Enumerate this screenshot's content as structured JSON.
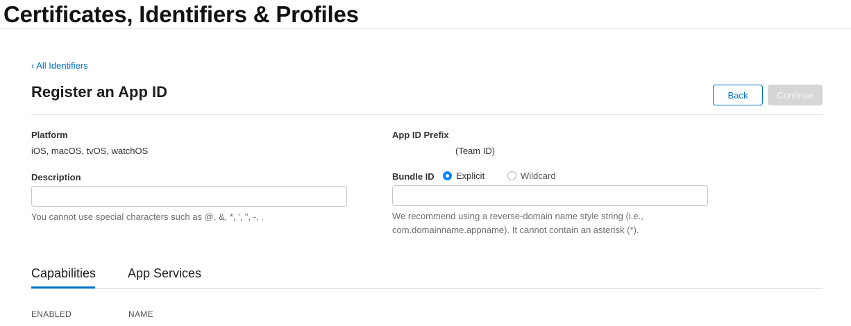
{
  "site": {
    "title": "Certificates, Identifiers & Profiles"
  },
  "nav": {
    "back_link": "‹ All Identifiers"
  },
  "page": {
    "title": "Register an App ID"
  },
  "actions": {
    "back_label": "Back",
    "continue_label": "Continue"
  },
  "platform": {
    "label": "Platform",
    "value": "iOS, macOS, tvOS, watchOS"
  },
  "app_id_prefix": {
    "label": "App ID Prefix",
    "value": "(Team ID)"
  },
  "description": {
    "label": "Description",
    "value": "",
    "hint": "You cannot use special characters such as @, &, *, ', \", -, ."
  },
  "bundle_id": {
    "label": "Bundle ID",
    "options": [
      {
        "label": "Explicit",
        "selected": true
      },
      {
        "label": "Wildcard",
        "selected": false
      }
    ],
    "value": "",
    "hint_line1": "We recommend using a reverse-domain name style string (i.e.,",
    "hint_line2": "com.domainname.appname). It cannot contain an asterisk (*)."
  },
  "tabs": [
    {
      "label": "Capabilities",
      "active": true
    },
    {
      "label": "App Services",
      "active": false
    }
  ],
  "table": {
    "columns": [
      "ENABLED",
      "NAME"
    ]
  },
  "colors": {
    "accent": "#0070c9",
    "radio": "#0a84ff",
    "disabled": "#d6d6d6"
  }
}
